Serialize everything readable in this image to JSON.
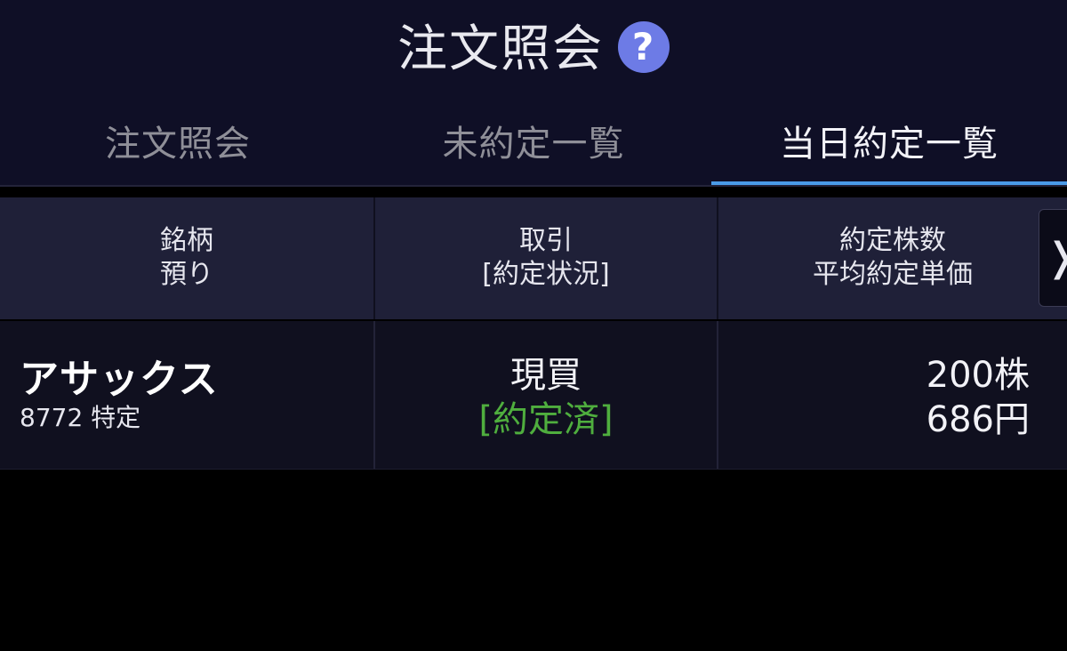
{
  "header": {
    "title": "注文照会",
    "help_icon": "question-mark-icon",
    "help_icon_color": "#6d7be6"
  },
  "tabs": [
    {
      "label": "注文照会",
      "active": false
    },
    {
      "label": "未約定一覧",
      "active": false
    },
    {
      "label": "当日約定一覧",
      "active": true
    }
  ],
  "accent_color": "#4a9be8",
  "table": {
    "columns": [
      {
        "line1": "銘柄",
        "line2": "預り"
      },
      {
        "line1": "取引",
        "line2": "[約定状況]"
      },
      {
        "line1": "約定株数",
        "line2": "平均約定単価"
      }
    ],
    "next_icon": "chevron-right-icon",
    "next_glyph": "❭",
    "rows": [
      {
        "name": "アサックス",
        "code_account": "8772 特定",
        "trade": "現買",
        "status": "[約定済]",
        "status_color": "#4fae3e",
        "quantity": "200株",
        "avg_price": "686円"
      }
    ]
  }
}
